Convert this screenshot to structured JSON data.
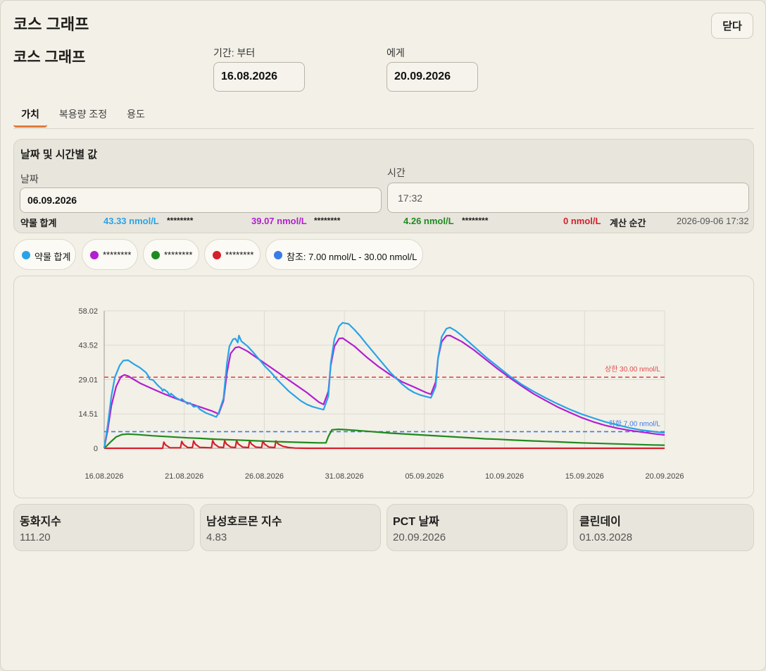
{
  "window": {
    "title": "코스 그래프",
    "close_label": "닫다"
  },
  "header": {
    "subtitle": "코스 그래프",
    "from_label": "기간: 부터",
    "from_value": "16.08.2026",
    "to_label": "에게",
    "to_value": "20.09.2026"
  },
  "tabs": [
    {
      "label": "가치",
      "active": true
    },
    {
      "label": "복용량 조정",
      "active": false
    },
    {
      "label": "용도",
      "active": false
    }
  ],
  "values_panel": {
    "title": "날짜 및 시간별 값",
    "date_label": "날짜",
    "date_value": "06.09.2026",
    "time_label": "시간",
    "time_value": "17:32",
    "total_label": "약물 합계",
    "total_value": "43.33 nmol/L",
    "s1_name": "********",
    "s1_value": "39.07 nmol/L",
    "s2_name": "********",
    "s2_value": "4.26 nmol/L",
    "s3_name": "********",
    "s3_value": "0 nmol/L",
    "calc_label": "계산 순간",
    "calc_value": "2026-09-06 17:32"
  },
  "legend": [
    {
      "label": "약물 합계",
      "color": "#29a3e8"
    },
    {
      "label": "********",
      "color": "#b21fd0"
    },
    {
      "label": "********",
      "color": "#1f8a1f"
    },
    {
      "label": "********",
      "color": "#d4212b"
    },
    {
      "label": "참조: 7.00 nmol/L - 30.00 nmol/L",
      "color": "#3b7be8"
    }
  ],
  "chart_data": {
    "type": "line",
    "x_dates": [
      "16.08.2026",
      "21.08.2026",
      "26.08.2026",
      "31.08.2026",
      "05.09.2026",
      "10.09.2026",
      "15.09.2026",
      "20.09.2026"
    ],
    "ylim": [
      0,
      58.02
    ],
    "yticks": [
      "58.02",
      "43.52",
      "29.01",
      "14.51",
      "0"
    ],
    "grid": true,
    "reference_lines": [
      {
        "label": "상한 30.00 nmol/L",
        "value": 30.0,
        "color": "#e14b4b"
      },
      {
        "label": "하한 7.00 nmol/L",
        "value": 7.0,
        "color": "#3b7be8"
      }
    ],
    "series": [
      {
        "name": "약물 합계",
        "color": "#29a3e8",
        "points": [
          [
            0,
            0
          ],
          [
            0.3,
            10
          ],
          [
            0.6,
            22
          ],
          [
            0.9,
            30
          ],
          [
            1.3,
            35
          ],
          [
            1.6,
            37
          ],
          [
            2,
            37.2
          ],
          [
            2.5,
            35.5
          ],
          [
            3,
            34
          ],
          [
            3.5,
            32
          ],
          [
            3.7,
            30.5
          ],
          [
            3.8,
            29.2
          ],
          [
            4.1,
            28.8
          ],
          [
            4.5,
            26.5
          ],
          [
            4.8,
            25.2
          ],
          [
            4.9,
            24.2
          ],
          [
            5,
            24.9
          ],
          [
            5.3,
            23.8
          ],
          [
            5.5,
            22.3
          ],
          [
            5.6,
            23.1
          ],
          [
            6,
            21.4
          ],
          [
            6.4,
            20.3
          ],
          [
            6.5,
            20.9
          ],
          [
            7,
            18.7
          ],
          [
            7.2,
            19.2
          ],
          [
            7.5,
            17.5
          ],
          [
            7.8,
            17.8
          ],
          [
            8,
            16.5
          ],
          [
            8.5,
            15
          ],
          [
            9,
            14
          ],
          [
            9.4,
            13.2
          ],
          [
            9.6,
            15
          ],
          [
            10,
            21
          ],
          [
            10.3,
            36
          ],
          [
            10.5,
            43
          ],
          [
            10.8,
            46
          ],
          [
            11,
            46.3
          ],
          [
            11.2,
            44.6
          ],
          [
            11.3,
            47.6
          ],
          [
            11.5,
            45.2
          ],
          [
            12,
            43.2
          ],
          [
            12.5,
            40.5
          ],
          [
            13,
            37.5
          ],
          [
            13.5,
            34.5
          ],
          [
            14,
            32
          ],
          [
            14.5,
            29
          ],
          [
            15,
            26.5
          ],
          [
            15.5,
            24
          ],
          [
            16,
            22
          ],
          [
            16.5,
            20
          ],
          [
            17,
            18.5
          ],
          [
            17.5,
            17.5
          ],
          [
            18,
            16.8
          ],
          [
            18.4,
            16.3
          ],
          [
            18.8,
            22
          ],
          [
            19,
            36
          ],
          [
            19.3,
            46
          ],
          [
            19.7,
            51.5
          ],
          [
            20,
            53
          ],
          [
            20.5,
            52.5
          ],
          [
            21,
            50
          ],
          [
            21.5,
            47.2
          ],
          [
            22,
            44
          ],
          [
            22.5,
            41
          ],
          [
            23,
            38
          ],
          [
            23.5,
            35
          ],
          [
            24,
            32
          ],
          [
            24.5,
            29.5
          ],
          [
            25,
            27
          ],
          [
            25.5,
            25
          ],
          [
            26,
            23.5
          ],
          [
            26.5,
            22.5
          ],
          [
            27,
            21.8
          ],
          [
            27.4,
            21.3
          ],
          [
            27.8,
            26
          ],
          [
            28,
            38
          ],
          [
            28.3,
            47
          ],
          [
            28.7,
            50.5
          ],
          [
            29,
            51
          ],
          [
            29.5,
            49.5
          ],
          [
            30,
            47.5
          ],
          [
            31,
            43
          ],
          [
            32,
            38.5
          ],
          [
            33,
            34.5
          ],
          [
            34,
            30.5
          ],
          [
            35,
            27
          ],
          [
            36,
            24
          ],
          [
            37,
            21.3
          ],
          [
            38,
            18.8
          ],
          [
            39,
            16.5
          ],
          [
            40,
            14.5
          ],
          [
            41,
            12.8
          ],
          [
            42,
            11.2
          ],
          [
            43,
            9.9
          ],
          [
            44,
            8.7
          ],
          [
            45,
            7.7
          ],
          [
            46,
            7.1
          ],
          [
            47,
            6.5
          ]
        ]
      },
      {
        "name": "********",
        "color": "#b21fd0",
        "points": [
          [
            0,
            0
          ],
          [
            0.3,
            8
          ],
          [
            0.6,
            18
          ],
          [
            1,
            26
          ],
          [
            1.4,
            30.2
          ],
          [
            1.7,
            31
          ],
          [
            2,
            30.5
          ],
          [
            2.5,
            29
          ],
          [
            3,
            27.5
          ],
          [
            4,
            25.2
          ],
          [
            5,
            23
          ],
          [
            6,
            21
          ],
          [
            7,
            19.2
          ],
          [
            8,
            17.5
          ],
          [
            9,
            15.8
          ],
          [
            9.6,
            14.5
          ],
          [
            10,
            20
          ],
          [
            10.3,
            32
          ],
          [
            10.6,
            40
          ],
          [
            11,
            42.5
          ],
          [
            11.3,
            42.8
          ],
          [
            12,
            41
          ],
          [
            13,
            37.5
          ],
          [
            14,
            34
          ],
          [
            15,
            30.5
          ],
          [
            16,
            27
          ],
          [
            17,
            23.5
          ],
          [
            17.5,
            21.5
          ],
          [
            18,
            19.5
          ],
          [
            18.4,
            18.5
          ],
          [
            18.8,
            24
          ],
          [
            19,
            35
          ],
          [
            19.3,
            43
          ],
          [
            19.7,
            46.3
          ],
          [
            20,
            46.5
          ],
          [
            21,
            43
          ],
          [
            22,
            38.5
          ],
          [
            23,
            34.5
          ],
          [
            24,
            31
          ],
          [
            25,
            28
          ],
          [
            26,
            25.8
          ],
          [
            27,
            23.5
          ],
          [
            27.4,
            22.8
          ],
          [
            27.8,
            28
          ],
          [
            28,
            38
          ],
          [
            28.3,
            45
          ],
          [
            28.7,
            47.5
          ],
          [
            29,
            47.6
          ],
          [
            30,
            45
          ],
          [
            31,
            41.5
          ],
          [
            32,
            37.5
          ],
          [
            33,
            33.5
          ],
          [
            34,
            29.8
          ],
          [
            35,
            26.3
          ],
          [
            36,
            23
          ],
          [
            37,
            20.2
          ],
          [
            38,
            17.5
          ],
          [
            39,
            15.2
          ],
          [
            40,
            13
          ],
          [
            41,
            11.2
          ],
          [
            42,
            9.7
          ],
          [
            43,
            8.5
          ],
          [
            44,
            7.6
          ],
          [
            45,
            6.9
          ],
          [
            46,
            6.2
          ],
          [
            47,
            5.6
          ]
        ]
      },
      {
        "name": "********",
        "color": "#1f8a1f",
        "points": [
          [
            0,
            0
          ],
          [
            0.5,
            2.5
          ],
          [
            1,
            4.8
          ],
          [
            1.5,
            5.8
          ],
          [
            2,
            6
          ],
          [
            3,
            5.7
          ],
          [
            4,
            5.3
          ],
          [
            5,
            5
          ],
          [
            6,
            4.7
          ],
          [
            7,
            4.4
          ],
          [
            8,
            4.2
          ],
          [
            9,
            3.9
          ],
          [
            10,
            3.7
          ],
          [
            11,
            3.5
          ],
          [
            12,
            3.3
          ],
          [
            13,
            3.1
          ],
          [
            14,
            2.9
          ],
          [
            15,
            2.7
          ],
          [
            16,
            2.55
          ],
          [
            17,
            2.4
          ],
          [
            18,
            2.3
          ],
          [
            18.6,
            2.3
          ],
          [
            18.8,
            5
          ],
          [
            19.1,
            7.8
          ],
          [
            19.6,
            8
          ],
          [
            20,
            7.9
          ],
          [
            21,
            7.6
          ],
          [
            22,
            7.2
          ],
          [
            23,
            6.8
          ],
          [
            24,
            6.4
          ],
          [
            25,
            6.1
          ],
          [
            26,
            5.8
          ],
          [
            27,
            5.5
          ],
          [
            28,
            5.2
          ],
          [
            29,
            4.9
          ],
          [
            30,
            4.6
          ],
          [
            31,
            4.3
          ],
          [
            32,
            4
          ],
          [
            33,
            3.8
          ],
          [
            34,
            3.55
          ],
          [
            35,
            3.3
          ],
          [
            36,
            3.1
          ],
          [
            37,
            2.9
          ],
          [
            38,
            2.7
          ],
          [
            39,
            2.5
          ],
          [
            40,
            2.3
          ],
          [
            41,
            2.15
          ],
          [
            42,
            2
          ],
          [
            43,
            1.85
          ],
          [
            44,
            1.7
          ],
          [
            45,
            1.55
          ],
          [
            46,
            1.4
          ],
          [
            47,
            1.3
          ]
        ]
      },
      {
        "name": "********",
        "color": "#d4212b",
        "points": [
          [
            0,
            0
          ],
          [
            4.9,
            0
          ],
          [
            5,
            2.6
          ],
          [
            5.15,
            1.4
          ],
          [
            5.4,
            0.6
          ],
          [
            5.5,
            0.2
          ],
          [
            6.4,
            0.2
          ],
          [
            6.5,
            2.9
          ],
          [
            6.65,
            1.6
          ],
          [
            6.9,
            0.7
          ],
          [
            7,
            0.3
          ],
          [
            7.4,
            0.3
          ],
          [
            7.5,
            3.1
          ],
          [
            7.65,
            1.7
          ],
          [
            7.9,
            0.8
          ],
          [
            8,
            0.4
          ],
          [
            9,
            0.2
          ],
          [
            9.1,
            3.2
          ],
          [
            9.25,
            1.8
          ],
          [
            9.5,
            0.9
          ],
          [
            9.6,
            0.5
          ],
          [
            10,
            0.3
          ],
          [
            10.1,
            3.2
          ],
          [
            10.25,
            1.8
          ],
          [
            10.5,
            0.9
          ],
          [
            10.6,
            0.5
          ],
          [
            11,
            0.3
          ],
          [
            11.1,
            3.2
          ],
          [
            11.25,
            1.8
          ],
          [
            11.5,
            0.9
          ],
          [
            11.6,
            0.5
          ],
          [
            12.1,
            0.3
          ],
          [
            12.2,
            3.2
          ],
          [
            12.35,
            1.8
          ],
          [
            12.6,
            0.9
          ],
          [
            12.7,
            0.5
          ],
          [
            13.2,
            0.3
          ],
          [
            13.3,
            3.1
          ],
          [
            13.45,
            1.8
          ],
          [
            13.7,
            0.9
          ],
          [
            13.8,
            0.5
          ],
          [
            14.3,
            0.3
          ],
          [
            14.4,
            3.1
          ],
          [
            14.6,
            1.8
          ],
          [
            15,
            0.8
          ],
          [
            15.5,
            0.3
          ],
          [
            16,
            0.1
          ],
          [
            17,
            0
          ],
          [
            47,
            0
          ]
        ]
      }
    ]
  },
  "stats": [
    {
      "title": "동화지수",
      "value": "111.20"
    },
    {
      "title": "남성호르몬 지수",
      "value": "4.83"
    },
    {
      "title": "PCT 날짜",
      "value": "20.09.2026"
    },
    {
      "title": "클린데이",
      "value": "01.03.2028"
    }
  ]
}
